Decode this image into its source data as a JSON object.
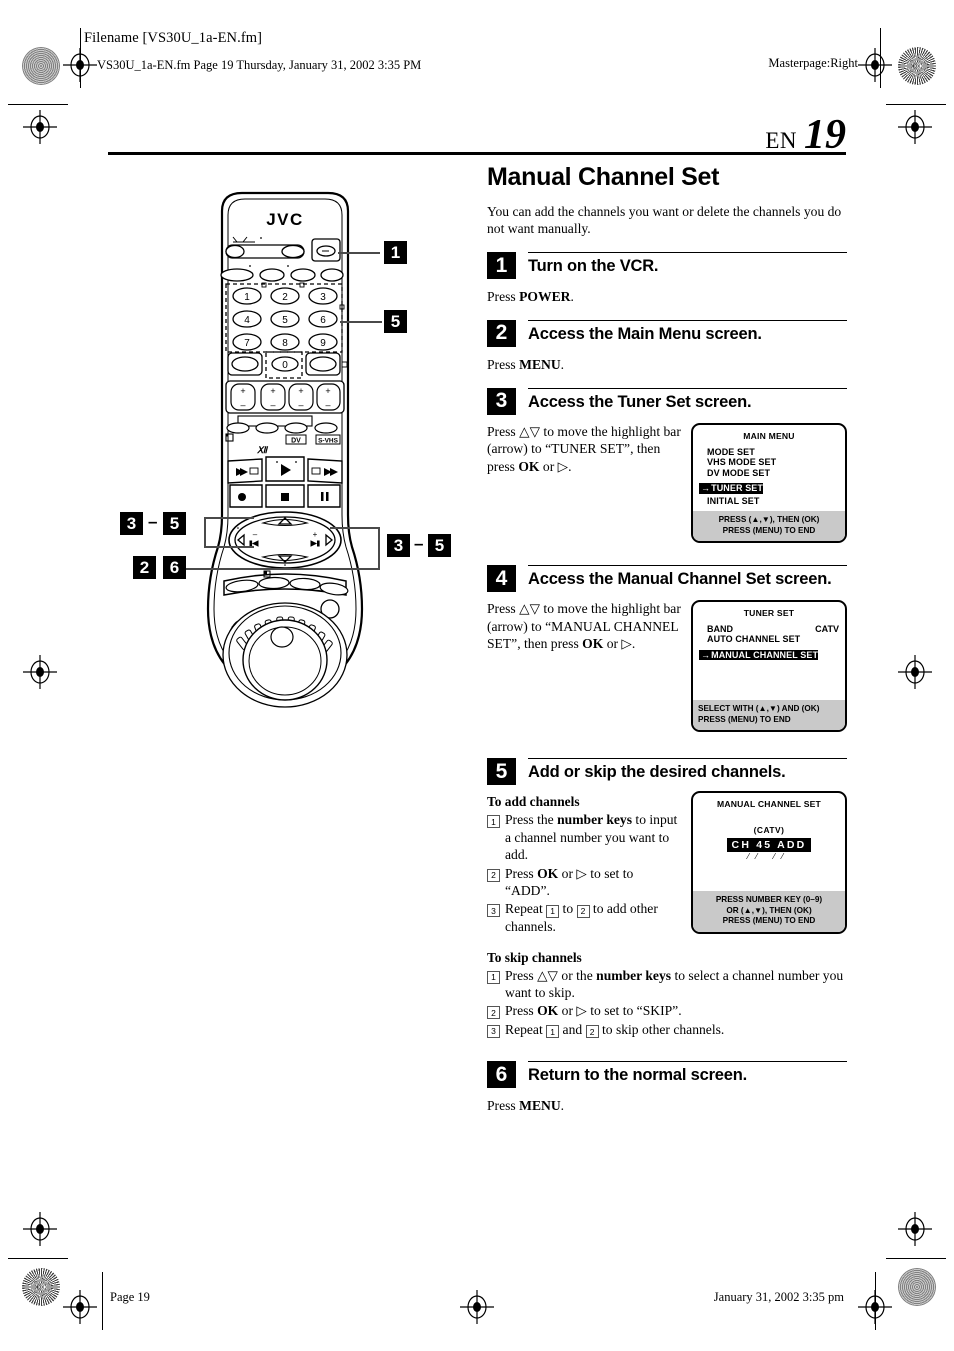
{
  "print_marks": {
    "filename_label": "Filename [VS30U_1a-EN.fm]",
    "fm_line": "VS30U_1a-EN.fm  Page 19  Thursday, January 31, 2002  3:35 PM",
    "masterpage": "Masterpage:Right",
    "footer_page": "Page 19",
    "footer_date": "January 31, 2002 3:35 pm"
  },
  "page_header": {
    "lang": "EN",
    "number": "19"
  },
  "doc": {
    "title": "Manual Channel Set",
    "intro": "You can add the channels you want or delete the channels you do not want manually."
  },
  "steps": {
    "s1": {
      "num": "1",
      "title": "Turn on the VCR.",
      "body_pre": "Press ",
      "body_bold": "POWER",
      "body_post": "."
    },
    "s2": {
      "num": "2",
      "title": "Access the Main Menu screen.",
      "body_pre": "Press ",
      "body_bold": "MENU",
      "body_post": "."
    },
    "s3": {
      "num": "3",
      "title": "Access the Tuner Set screen.",
      "text_1": "Press ",
      "text_arrows": "△▽",
      "text_2": " to move the highlight bar (arrow) to “TUNER SET”, then press ",
      "text_bold": "OK",
      "text_3": " or ",
      "text_tri": "▷",
      "text_4": "."
    },
    "s4": {
      "num": "4",
      "title": "Access the Manual Channel Set screen.",
      "text_1": "Press ",
      "text_arrows": "△▽",
      "text_2": " to move the highlight bar (arrow) to “MANUAL CHANNEL SET”, then press ",
      "text_bold": "OK",
      "text_3": " or ",
      "text_tri": "▷",
      "text_4": "."
    },
    "s5": {
      "num": "5",
      "title": "Add or skip the desired channels.",
      "add_heading": "To add channels",
      "add_items": [
        {
          "n": "1",
          "pre": "Press the ",
          "bold": "number keys",
          "post": " to input a channel number you want to add."
        },
        {
          "n": "2",
          "pre": "Press ",
          "bold": "OK",
          "post": " or ▷ to set to “ADD”."
        },
        {
          "n": "3",
          "pre": "Repeat ",
          "bold": "",
          "post": " to add other channels.",
          "ref_a": "1",
          "ref_b": "2",
          "joiner": " to "
        }
      ],
      "skip_heading": "To skip channels",
      "skip_items": [
        {
          "n": "1",
          "pre": "Press △▽ or the ",
          "bold": "number keys",
          "post": " to select a channel number you want to skip."
        },
        {
          "n": "2",
          "pre": "Press ",
          "bold": "OK",
          "post": " or ▷ to set to “SKIP”."
        },
        {
          "n": "3",
          "pre": "Repeat ",
          "bold": "",
          "post": " to skip other channels.",
          "ref_a": "1",
          "ref_b": "2",
          "joiner": " and "
        }
      ]
    },
    "s6": {
      "num": "6",
      "title": "Return to the normal screen.",
      "body_pre": "Press ",
      "body_bold": "MENU",
      "body_post": "."
    }
  },
  "osd": {
    "main_menu": {
      "title": "MAIN MENU",
      "items": [
        "MODE SET",
        "VHS MODE SET",
        "DV MODE SET",
        "TUNER SET",
        "INITIAL SET"
      ],
      "selected_index": 3,
      "arrow": "→",
      "footer_line1": "PRESS (▲,▼), THEN (OK)",
      "footer_line2": "PRESS (MENU) TO END"
    },
    "tuner_set": {
      "title": "TUNER SET",
      "band_label": "BAND",
      "band_value": "CATV",
      "items": [
        "AUTO CHANNEL SET",
        "MANUAL CHANNEL SET"
      ],
      "selected_index": 1,
      "arrow": "→",
      "footer_line1": "SELECT WITH (▲,▼) AND (OK)",
      "footer_line2": "PRESS (MENU) TO END"
    },
    "manual_channel_set": {
      "title": "MANUAL CHANNEL SET",
      "band_tag": "(CATV)",
      "ch_label": "CH",
      "ch_number": "45",
      "ch_state": "ADD",
      "footer_line1": "PRESS NUMBER KEY (0–9)",
      "footer_line2": "OR (▲,▼), THEN (OK)",
      "footer_line3": "PRESS (MENU) TO END"
    }
  },
  "remote": {
    "brand": "JVC",
    "number_keys": [
      "1",
      "2",
      "3",
      "4",
      "5",
      "6",
      "7",
      "8",
      "9",
      "0"
    ],
    "labels": {
      "dv": "DV",
      "svhs": "S-VHS"
    },
    "callouts": [
      {
        "id": "c1",
        "text": "1"
      },
      {
        "id": "c5",
        "text": "5"
      },
      {
        "id": "c3a",
        "text": "3"
      },
      {
        "id": "c5a",
        "text": "5"
      },
      {
        "id": "c3b",
        "text": "3"
      },
      {
        "id": "c5b",
        "text": "5"
      },
      {
        "id": "c2",
        "text": "2"
      },
      {
        "id": "c6",
        "text": "6"
      }
    ],
    "dash": "–"
  }
}
